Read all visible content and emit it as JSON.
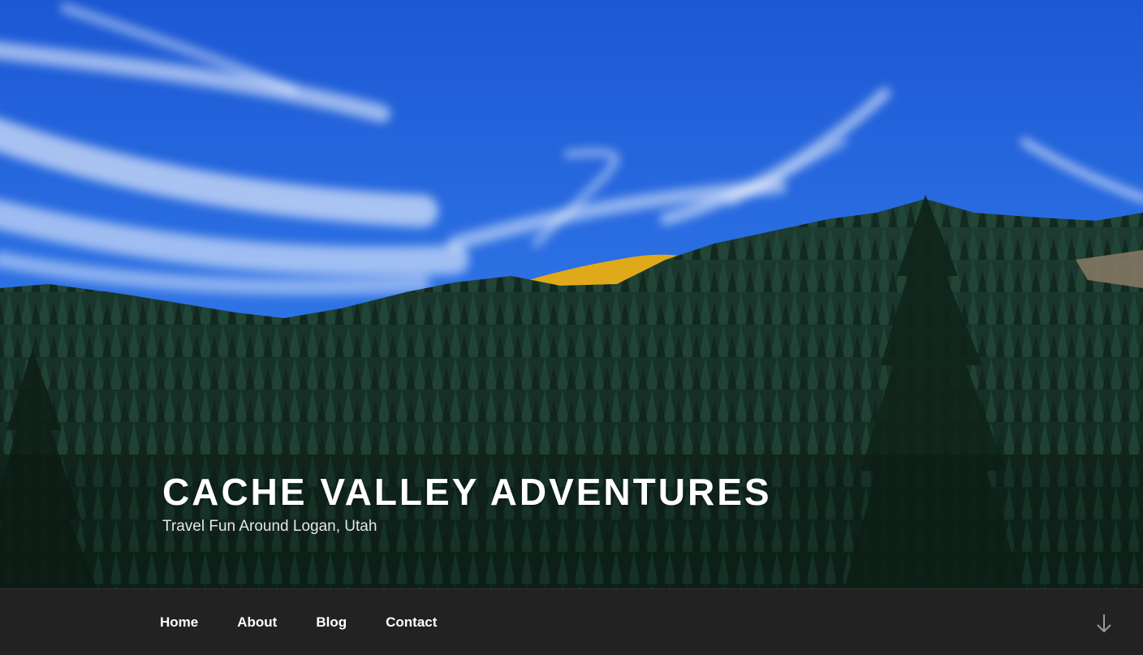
{
  "site": {
    "title": "CACHE VALLEY ADVENTURES",
    "tagline": "Travel Fun Around Logan, Utah"
  },
  "hero": {
    "image_subject": "evergreen forest hillside with yellow aspens under blue sky with wispy clouds",
    "colors": {
      "sky_top": "#1f5fd8",
      "sky_bottom": "#4d8ef0",
      "forest": "#17342a",
      "aspen": "#e0a91a"
    }
  },
  "nav": {
    "items": [
      {
        "label": "Home"
      },
      {
        "label": "About"
      },
      {
        "label": "Blog"
      },
      {
        "label": "Contact"
      }
    ],
    "scroll_icon": "arrow-down-icon",
    "background": "#222222"
  }
}
